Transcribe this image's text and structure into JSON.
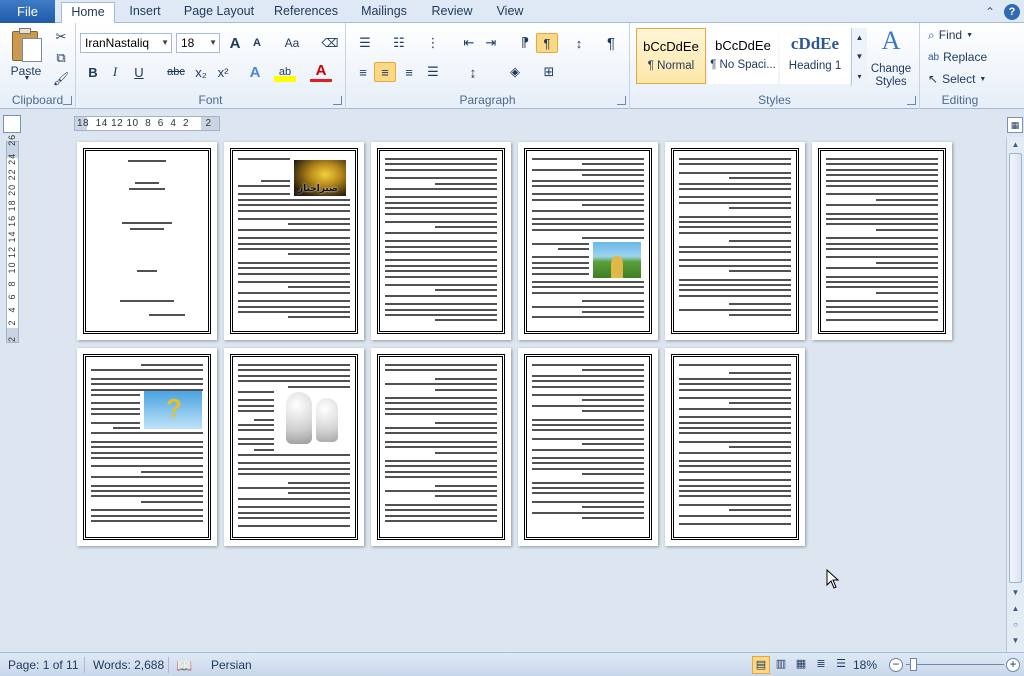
{
  "tabs": {
    "file": "File",
    "items": [
      "Home",
      "Insert",
      "Page Layout",
      "References",
      "Mailings",
      "Review",
      "View"
    ]
  },
  "clipboard": {
    "paste": "Paste",
    "label": "Clipboard"
  },
  "font": {
    "name": "IranNastaliq",
    "size": "18",
    "label": "Font",
    "bold": "B",
    "italic": "I",
    "underline": "U",
    "strike": "abc",
    "subscript": "x₂",
    "superscript": "x²",
    "grow": "A",
    "shrink": "A",
    "case": "Aa",
    "highlight": "ab",
    "color": "A"
  },
  "paragraph": {
    "label": "Paragraph",
    "show_marks": "¶"
  },
  "styles": {
    "label": "Styles",
    "items": [
      {
        "sample": "bCcDdEe",
        "name": "¶ Normal"
      },
      {
        "sample": "bCcDdEe",
        "name": "¶ No Spaci..."
      },
      {
        "sample": "cDdEe",
        "name": "Heading 1"
      }
    ],
    "change": "Change Styles"
  },
  "editing": {
    "label": "Editing",
    "find": "Find",
    "replace": "Replace",
    "select": "Select"
  },
  "ruler": {
    "horizontal": "18  14 12 10  8  6  4  2     2",
    "vertical": "2   2  4  6  8  10 12 14 16 18 20 22 24  26"
  },
  "page_images": {
    "fire_text": "صبراخبار"
  },
  "status": {
    "page": "Page: 1 of 11",
    "words": "Words: 2,688",
    "language": "Persian",
    "zoom": "18%"
  },
  "colors": {
    "accent": "#2b5797",
    "ribbon_text": "#1e395b",
    "selected": "#fbd885"
  }
}
